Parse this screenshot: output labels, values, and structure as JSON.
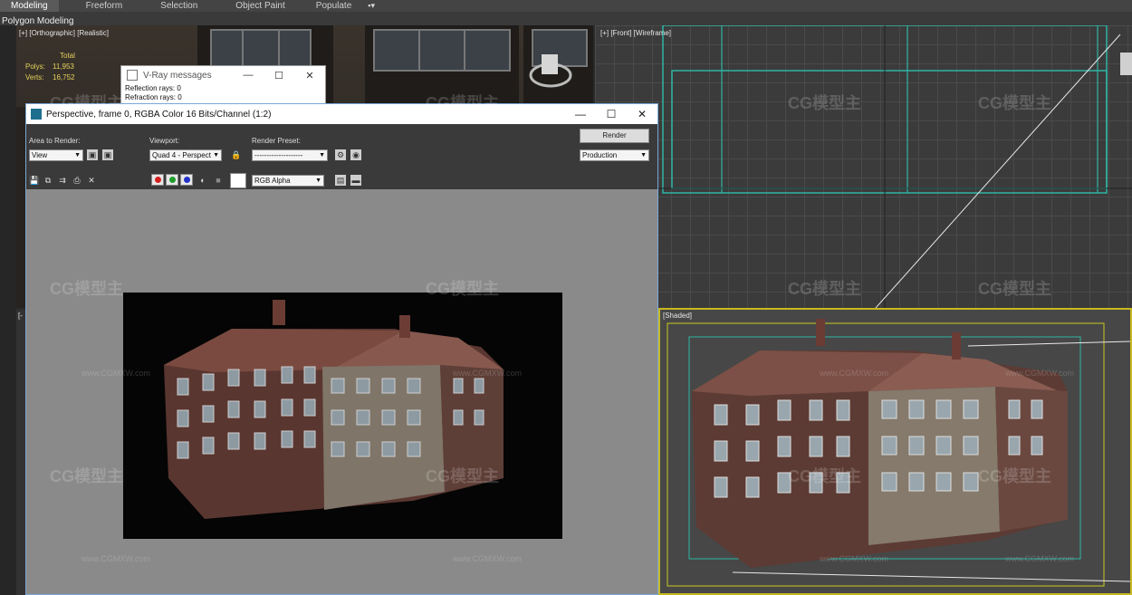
{
  "ribbon": {
    "tabs": [
      "Modeling",
      "Freeform",
      "Selection",
      "Object Paint",
      "Populate"
    ],
    "active_tab": "Modeling",
    "extra": "▪▾",
    "sub_label": "Polygon Modeling"
  },
  "viewports": {
    "top_left_label": "[+] [Orthographic] [Realistic]",
    "top_right_label": "[+] [Front] [Wireframe]",
    "bottom_left_label": "[-",
    "bottom_right_label": "[Shaded]"
  },
  "stats": {
    "header": "Total",
    "polys_label": "Polys:",
    "polys_value": "11,953",
    "verts_label": "Verts:",
    "verts_value": "16,752"
  },
  "vray_window": {
    "title": "V-Ray messages",
    "line1": "Reflection rays: 0",
    "line2": "Refraction rays: 0"
  },
  "frame_buffer": {
    "title": "Perspective, frame 0, RGBA Color 16 Bits/Channel (1:2)",
    "area_label": "Area to Render:",
    "area_value": "View",
    "viewport_label": "Viewport:",
    "viewport_value": "Quad 4 - Perspect",
    "preset_label": "Render Preset:",
    "preset_value": "--------------------",
    "render_button": "Render",
    "mode_value": "Production",
    "channel_value": "RGB Alpha"
  },
  "window_controls": {
    "minimize": "—",
    "maximize": "☐",
    "close": "✕"
  },
  "watermark": {
    "logo": "CG模型主",
    "url": "www.CGMXW.com"
  },
  "colors": {
    "selected_viewport_border": "#c8b820",
    "wire_cyan": "#2fb5a5",
    "stats_yellow": "#e5d35a"
  }
}
